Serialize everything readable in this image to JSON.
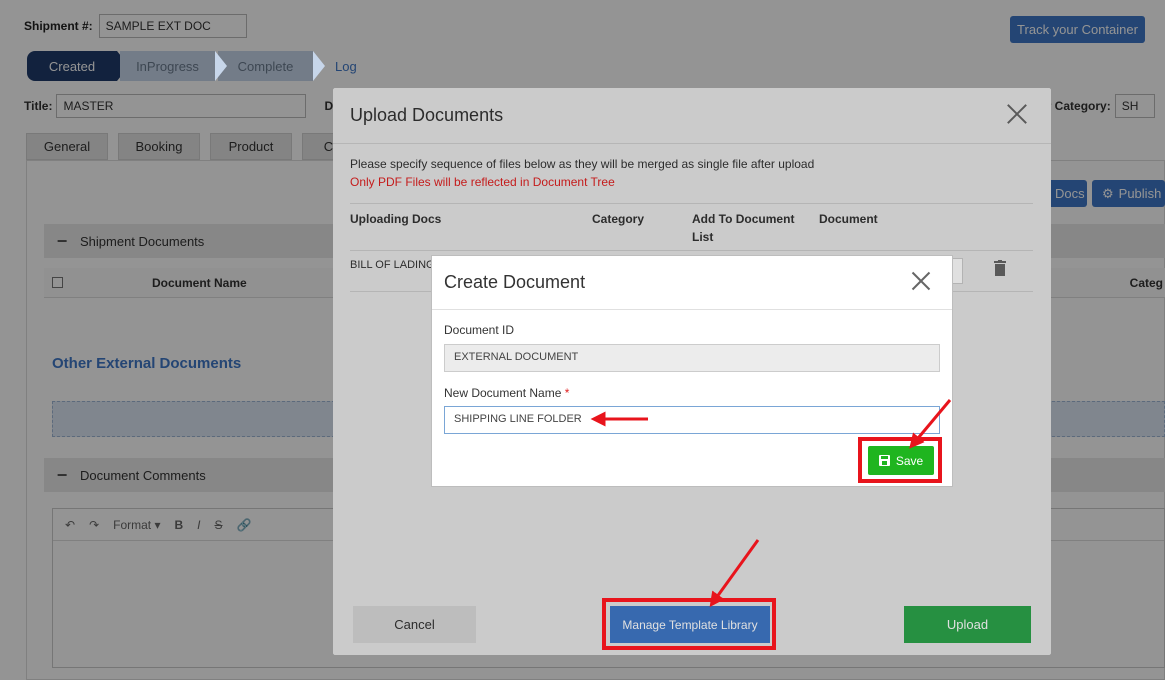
{
  "background": {
    "shipment_label": "Shipment #:",
    "shipment_value": "SAMPLE EXT DOC",
    "track_button": "Track your Container",
    "steps": [
      "Created",
      "InProgress",
      "Complete"
    ],
    "log_link": "Log",
    "title_label": "Title:",
    "title_value": "MASTER",
    "title_extra": "D",
    "category_label": "er Category:",
    "category_value": "SH",
    "tabs": [
      "General",
      "Booking",
      "Product",
      "Co"
    ],
    "docs_button": "Docs",
    "publish_button": "Publish",
    "shipment_documents": "Shipment Documents",
    "document_name_col": "Document Name",
    "category_col": "Categ",
    "other_external_documents": "Other External Documents",
    "document_comments": "Document Comments",
    "editor_format": "Format"
  },
  "upload_modal": {
    "title": "Upload Documents",
    "note": "Please specify sequence of files below as they will be merged as single file after upload",
    "warning": "Only PDF Files will be reflected in Document Tree",
    "columns": [
      "Uploading Docs",
      "Category",
      "Add To Document List",
      "Document"
    ],
    "row_doc": "BILL OF LADING",
    "cancel_button": "Cancel",
    "template_button": "Manage Template Library",
    "upload_button": "Upload"
  },
  "create_modal": {
    "title": "Create Document",
    "doc_id_label": "Document ID",
    "doc_id_value": "EXTERNAL DOCUMENT",
    "name_label": "New Document Name",
    "required_mark": "*",
    "name_value": "SHIPPING LINE FOLDER",
    "save_button": "Save"
  },
  "colors": {
    "accent": "#3f78c8",
    "save_green": "#1fb51f",
    "upload_green": "#2ca44a",
    "highlight_red": "#e8141c",
    "warning_red": "#e02020"
  }
}
